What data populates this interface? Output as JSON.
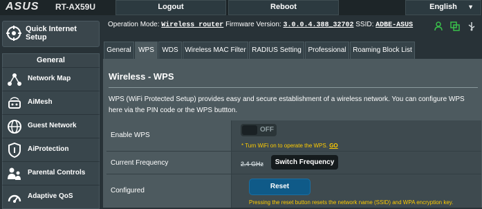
{
  "header": {
    "brand": "ASUS",
    "model": "RT-AX59U",
    "logout_label": "Logout",
    "reboot_label": "Reboot",
    "language": "English"
  },
  "sidebar": {
    "quick_setup_line1": "Quick Internet",
    "quick_setup_line2": "Setup",
    "general_label": "General",
    "items": [
      {
        "label": "Network Map",
        "icon": "network-map-icon"
      },
      {
        "label": "AiMesh",
        "icon": "aimesh-icon"
      },
      {
        "label": "Guest Network",
        "icon": "guest-network-icon"
      },
      {
        "label": "AiProtection",
        "icon": "aiprotection-icon"
      },
      {
        "label": "Parental Controls",
        "icon": "parental-controls-icon"
      },
      {
        "label": "Adaptive QoS",
        "icon": "adaptive-qos-icon"
      }
    ]
  },
  "info": {
    "opmode_label": "Operation Mode:",
    "opmode_value": "Wireless router",
    "firmware_label": "Firmware Version:",
    "firmware_value": "3.0.0.4.388_32702",
    "ssid_label": "SSID:",
    "ssid_value": "ADBE-ASUS"
  },
  "tabs": [
    "General",
    "WPS",
    "WDS",
    "Wireless MAC Filter",
    "RADIUS Setting",
    "Professional",
    "Roaming Block List"
  ],
  "active_tab": "WPS",
  "panel": {
    "title": "Wireless - WPS",
    "description": "WPS (WiFi Protected Setup) provides easy and secure establishment of a wireless network. You can configure WPS here via the PIN code or the WPS buttton."
  },
  "rows": {
    "enable_label": "Enable WPS",
    "toggle_state": "OFF",
    "enable_note": "* Turn WiFi on to operate the WPS.",
    "enable_note_link": "GO",
    "freq_label": "Current Frequency",
    "freq_value": "2.4 GHz",
    "switch_label": "Switch Frequency",
    "configured_label": "Configured",
    "reset_label": "Reset",
    "reset_note": "Pressing the reset button resets the network name (SSID) and WPA encryption key."
  },
  "colors": {
    "accent_warning": "#ffcc00",
    "reset_button": "#0f5a88",
    "status_green": "#39c04a"
  }
}
